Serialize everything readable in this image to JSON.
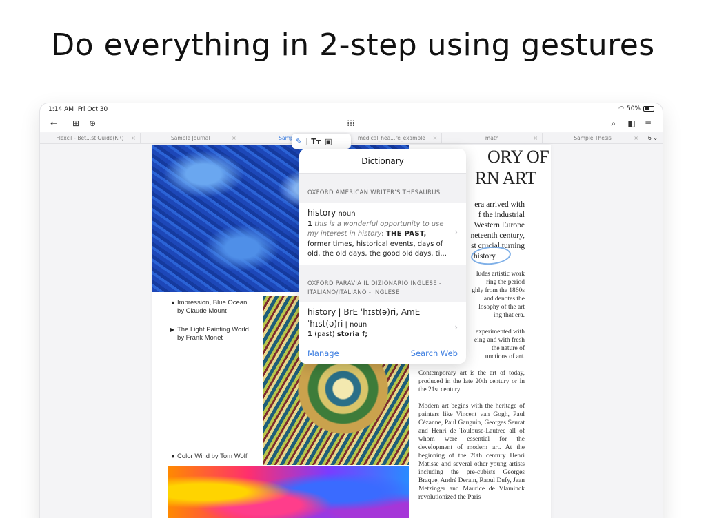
{
  "headline": "Do everything in 2-step using gestures",
  "status": {
    "time": "1:14 AM",
    "date": "Fri Oct 30",
    "battery": "50%"
  },
  "toolbar": {
    "icons": [
      "back-arrow-icon",
      "grid-icon",
      "add-page-icon",
      "apps-grid-icon",
      "search-icon",
      "view-toggle-icon",
      "menu-icon"
    ]
  },
  "tabs": [
    {
      "label": "Flexcil - Bet...st Guide(KR)",
      "active": false
    },
    {
      "label": "Sample Journal",
      "active": false
    },
    {
      "label": "Sample A",
      "active": true
    },
    {
      "label": "medical_hea...re_example",
      "active": false
    },
    {
      "label": "math",
      "active": false
    },
    {
      "label": "Sample Thesis",
      "active": false
    }
  ],
  "tab_count": "6",
  "document": {
    "title_line1": "ORY OF",
    "title_line2": "RN ART",
    "lead_lines": [
      "era arrived with",
      "f the industrial",
      "Western Europe",
      "neteenth century,",
      "st crucial turning"
    ],
    "highlight_word": "history.",
    "captions": [
      {
        "marker": "▲",
        "line1": "Impression, Blue Ocean",
        "line2": "by Claude Mount"
      },
      {
        "marker": "▶",
        "line1": "The Light Painting World",
        "line2": "by Frank Monet"
      },
      {
        "marker": "▼",
        "line1": "Color Wind by Tom Wolf",
        "line2": ""
      }
    ],
    "body_top": [
      "ludes artistic work",
      "ring the period",
      "ghly from the 1860s",
      "and denotes the",
      "losophy of the art",
      "ing that era."
    ],
    "body_mid": [
      "experimented with",
      "eing and with fresh",
      "the nature of",
      "unctions of art."
    ],
    "body_p3": "Contemporary art is the art of today, produced in the late 20th century or in the 21st century.",
    "body_p4": "Modern art begins with the heritage of painters like Vincent van Gogh, Paul Cézanne, Paul Gauguin, Georges Seurat and Henri de Toulouse-Lautrec all of whom were essential for the development of modern art. At the beginning of the 20th century Henri Matisse and several other young artists including the pre-cubists Georges Braque, André Derain, Raoul Dufy, Jean Metzinger and Maurice de Vlaminck revolutionized the Paris"
  },
  "dictionary": {
    "title": "Dictionary",
    "section1": "OXFORD AMERICAN WRITER'S THESAURUS",
    "entry1": {
      "word": "history",
      "pos": "noun",
      "num": "1",
      "example": "this is a wonderful opportunity to use my interest in history",
      "sense": "THE PAST,",
      "synonyms": "former times, historical events, days of old, the old days, the good old days, ti..."
    },
    "section2": "OXFORD PARAVIA IL DIZIONARIO INGLESE - ITALIANO/ITALIANO - INGLESE",
    "entry2": {
      "word": "history",
      "pron1": "| BrE ˈhɪst(ə)ri, AmE",
      "pron2": "ˈhɪst(ə)ri",
      "pos": "| noun",
      "num": "1",
      "gloss_label": "(past)",
      "gloss": "storia f;"
    },
    "manage": "Manage",
    "search_web": "Search Web"
  }
}
